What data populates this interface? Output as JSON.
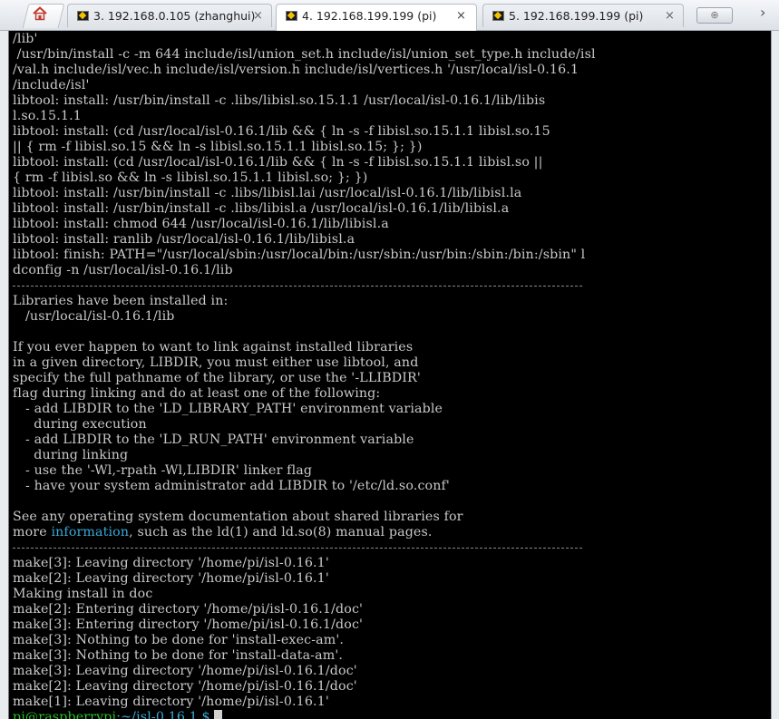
{
  "tabs": [
    {
      "label": "3. 192.168.0.105 (zhanghui)",
      "close": "×",
      "active": false
    },
    {
      "label": "4. 192.168.199.199 (pi)",
      "close": "×",
      "active": true
    },
    {
      "label": "5. 192.168.199.199 (pi)",
      "close": "×",
      "active": false
    }
  ],
  "home_icon": "home-icon",
  "tab_icon": "terminal-tab-icon",
  "new_tab_label": "⊕",
  "scroll_tabs": "›",
  "colors": {
    "terminal_bg": "#000000",
    "terminal_fg": "#c9c9c9",
    "highlight": "#3aa9d8",
    "prompt_user": "#28c028",
    "home_icon": "#d6452c"
  },
  "terminal": {
    "lines": [
      "/lib'",
      " /usr/bin/install -c -m 644 include/isl/union_set.h include/isl/union_set_type.h include/isl",
      "/val.h include/isl/vec.h include/isl/version.h include/isl/vertices.h '/usr/local/isl-0.16.1",
      "/include/isl'",
      "libtool: install: /usr/bin/install -c .libs/libisl.so.15.1.1 /usr/local/isl-0.16.1/lib/libis",
      "l.so.15.1.1",
      "libtool: install: (cd /usr/local/isl-0.16.1/lib && { ln -s -f libisl.so.15.1.1 libisl.so.15",
      "|| { rm -f libisl.so.15 && ln -s libisl.so.15.1.1 libisl.so.15; }; })",
      "libtool: install: (cd /usr/local/isl-0.16.1/lib && { ln -s -f libisl.so.15.1.1 libisl.so ||",
      "{ rm -f libisl.so && ln -s libisl.so.15.1.1 libisl.so; }; })",
      "libtool: install: /usr/bin/install -c .libs/libisl.lai /usr/local/isl-0.16.1/lib/libisl.la",
      "libtool: install: /usr/bin/install -c .libs/libisl.a /usr/local/isl-0.16.1/lib/libisl.a",
      "libtool: install: chmod 644 /usr/local/isl-0.16.1/lib/libisl.a",
      "libtool: install: ranlib /usr/local/isl-0.16.1/lib/libisl.a",
      "libtool: finish: PATH=\"/usr/local/sbin:/usr/local/bin:/usr/sbin:/usr/bin:/sbin:/bin:/sbin\" l",
      "dconfig -n /usr/local/isl-0.16.1/lib",
      "---SEP---",
      "Libraries have been installed in:",
      "   /usr/local/isl-0.16.1/lib",
      "",
      "If you ever happen to want to link against installed libraries",
      "in a given directory, LIBDIR, you must either use libtool, and",
      "specify the full pathname of the library, or use the '-LLIBDIR'",
      "flag during linking and do at least one of the following:",
      "   - add LIBDIR to the 'LD_LIBRARY_PATH' environment variable",
      "     during execution",
      "   - add LIBDIR to the 'LD_RUN_PATH' environment variable",
      "     during linking",
      "   - use the '-Wl,-rpath -Wl,LIBDIR' linker flag",
      "   - have your system administrator add LIBDIR to '/etc/ld.so.conf'",
      "",
      "See any operating system documentation about shared libraries for",
      "---INFO---",
      "---SEP---",
      "make[3]: Leaving directory '/home/pi/isl-0.16.1'",
      "make[2]: Leaving directory '/home/pi/isl-0.16.1'",
      "Making install in doc",
      "make[2]: Entering directory '/home/pi/isl-0.16.1/doc'",
      "make[3]: Entering directory '/home/pi/isl-0.16.1/doc'",
      "make[3]: Nothing to be done for 'install-exec-am'.",
      "make[3]: Nothing to be done for 'install-data-am'.",
      "make[3]: Leaving directory '/home/pi/isl-0.16.1/doc'",
      "make[2]: Leaving directory '/home/pi/isl-0.16.1/doc'",
      "make[1]: Leaving directory '/home/pi/isl-0.16.1'"
    ],
    "info_line": {
      "before": "more ",
      "highlight": "information",
      "after": ", such as the ld(1) and ld.so(8) manual pages."
    },
    "prompt": {
      "user_host": "pi@raspberrypi",
      "path": ":~/isl-0.16.1 $ "
    }
  }
}
